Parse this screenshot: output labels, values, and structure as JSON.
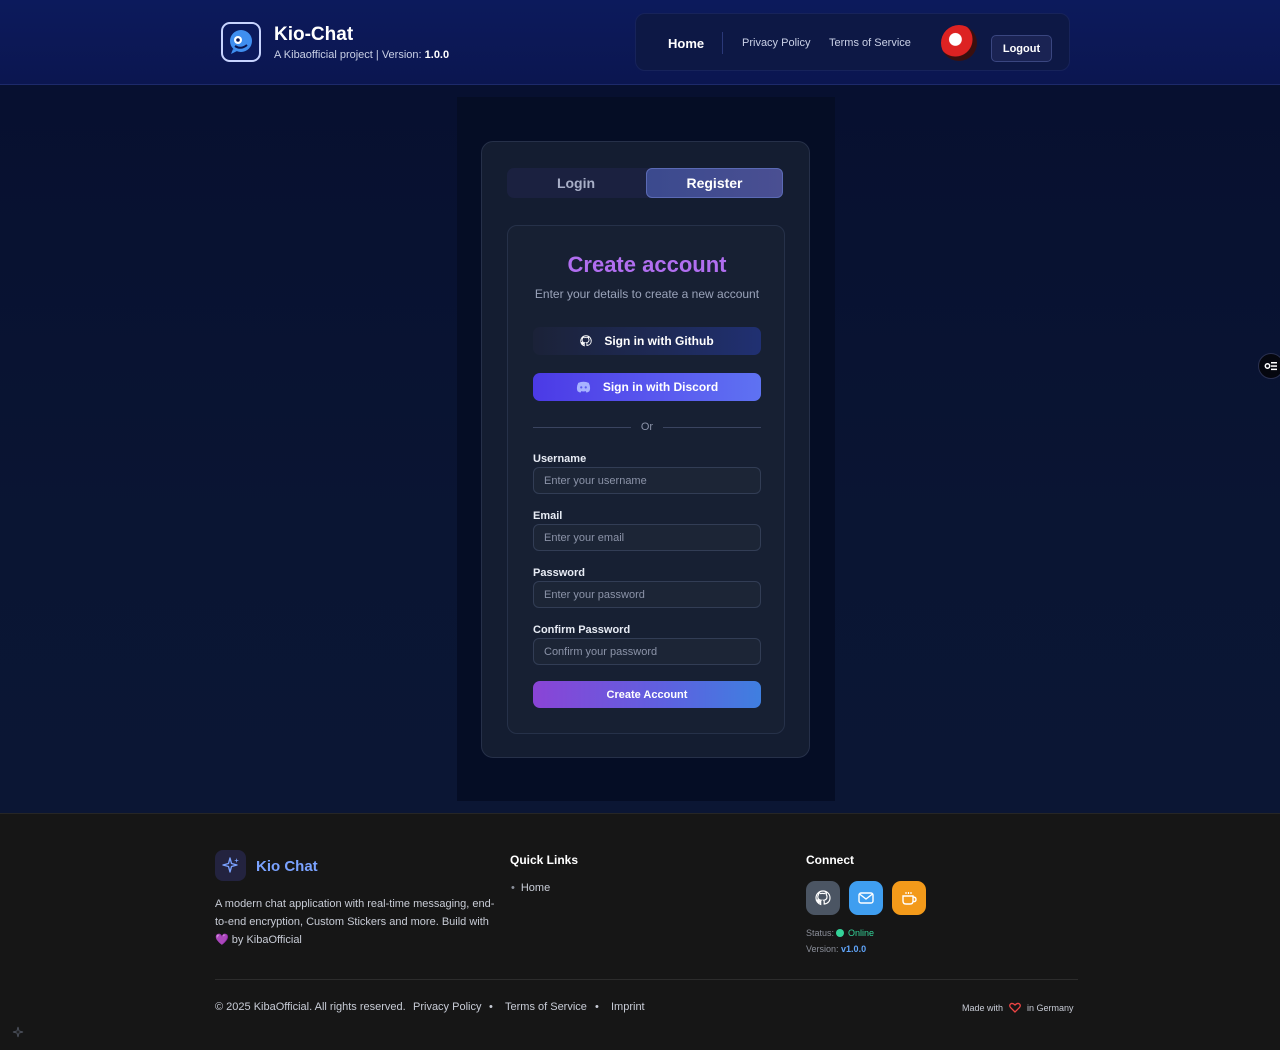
{
  "header": {
    "title": "Kio-Chat",
    "subtitle_prefix": "A Kibaofficial project | Version:",
    "version": "1.0.0",
    "nav": {
      "home": "Home",
      "privacy": "Privacy Policy",
      "terms": "Terms of Service"
    },
    "logout": "Logout"
  },
  "auth": {
    "tabs": {
      "login": "Login",
      "register": "Register"
    },
    "active_tab": "Register",
    "title": "Create account",
    "subtitle": "Enter your details to create a new account",
    "github_button": "Sign in with Github",
    "discord_button": "Sign in with Discord",
    "divider": "Or",
    "fields": {
      "username": {
        "label": "Username",
        "placeholder": "Enter your username"
      },
      "email": {
        "label": "Email",
        "placeholder": "Enter your email"
      },
      "password": {
        "label": "Password",
        "placeholder": "Enter your password"
      },
      "confirm": {
        "label": "Confirm Password",
        "placeholder": "Confirm your password"
      }
    },
    "submit": "Create Account"
  },
  "footer": {
    "brand": "Kio Chat",
    "description_a": "A modern chat application with real-time messaging, end-to-end encryption, Custom Stickers and more. Build with",
    "description_b": "by KibaOfficial",
    "quick_links_heading": "Quick Links",
    "quick_links": [
      "Home"
    ],
    "connect_heading": "Connect",
    "social_icons": [
      "github-icon",
      "mail-icon",
      "coffee-icon"
    ],
    "status_label": "Status:",
    "status_value": "Online",
    "version_label": "Version:",
    "version_value": "v1.0.0",
    "copyright": "© 2025 KibaOfficial. All rights reserved.",
    "bottom_links": {
      "privacy": "Privacy Policy",
      "terms": "Terms of Service",
      "imprint": "Imprint"
    },
    "bullet": "•",
    "made_prefix": "Made with",
    "made_suffix": "in Germany"
  },
  "colors": {
    "header_bg": "#0c1a5c",
    "accent_purple": "#b16ef0",
    "discord": "#5865f2",
    "status_online": "#34d399"
  }
}
